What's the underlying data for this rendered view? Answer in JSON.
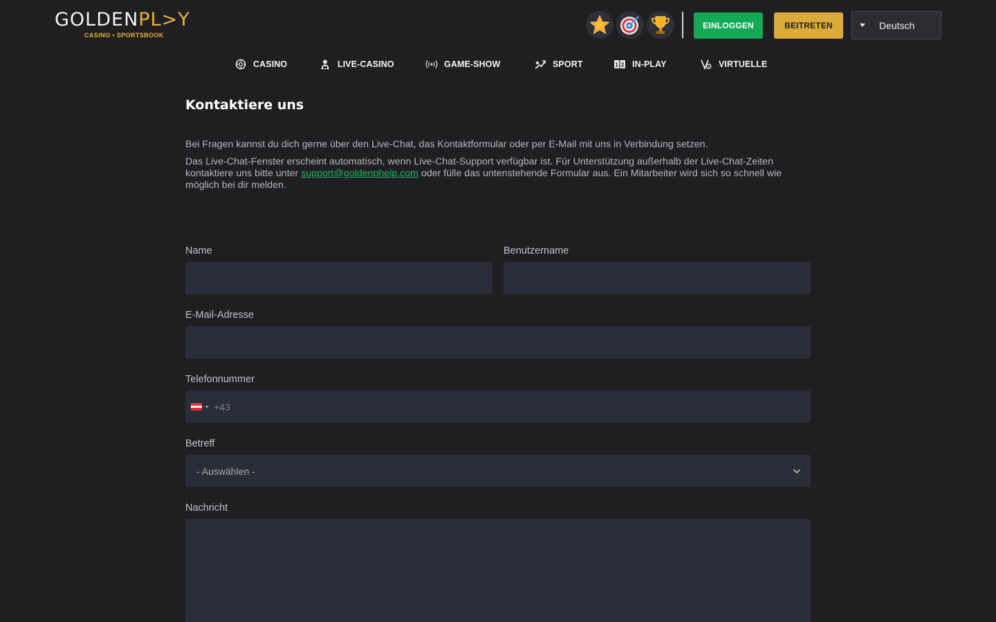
{
  "header": {
    "logo": {
      "main_left": "GOLDEN",
      "main_right": "PL>Y",
      "sub": "CASINO • SPORTSBOOK"
    },
    "badges": [
      {
        "icon": "star-badge-icon"
      },
      {
        "icon": "target-badge-icon"
      },
      {
        "icon": "trophy-badge-icon"
      }
    ],
    "login_label": "EINLOGGEN",
    "join_label": "BEITRETEN",
    "language": "Deutsch"
  },
  "nav": {
    "items": [
      {
        "label": "CASINO",
        "icon": "casino-chip-icon"
      },
      {
        "label": "LIVE-CASINO",
        "icon": "dealer-icon"
      },
      {
        "label": "GAME-SHOW",
        "icon": "broadcast-icon"
      },
      {
        "label": "SPORT",
        "icon": "sport-icon"
      },
      {
        "label": "IN-PLAY",
        "icon": "scoreboard-icon"
      },
      {
        "label": "VIRTUELLE",
        "icon": "virtual-icon"
      }
    ]
  },
  "main": {
    "title": "Kontaktiere uns",
    "intro_p1": "Bei Fragen kannst du dich gerne über den Live-Chat, das Kontaktformular oder per E-Mail mit uns in Verbindung setzen.",
    "intro_p2_before": "Das Live-Chat-Fenster erscheint automatisch, wenn Live-Chat-Support verfügbar ist. Für Unterstützung außerhalb der Live-Chat-Zeiten kontaktiere uns bitte unter ",
    "intro_p2_link": "support@goldenphelp.com",
    "intro_p2_after": " oder fülle das untenstehende Formular aus. Ein Mitarbeiter wird sich so schnell wie möglich bei dir melden."
  },
  "form": {
    "name_label": "Name",
    "username_label": "Benutzername",
    "email_label": "E-Mail-Adresse",
    "phone_label": "Telefonnummer",
    "phone_prefix": "+43",
    "phone_flag": "austria-flag-icon",
    "subject_label": "Betreff",
    "subject_selected": "- Auswählen -",
    "message_label": "Nachricht"
  },
  "colors": {
    "background": "#1f1f22",
    "field_bg": "#2a2d37",
    "login_green": "#14a857",
    "join_gold": "#dcaa3a",
    "link_green": "#1fb760",
    "brand_gold": "#e8b33b"
  }
}
